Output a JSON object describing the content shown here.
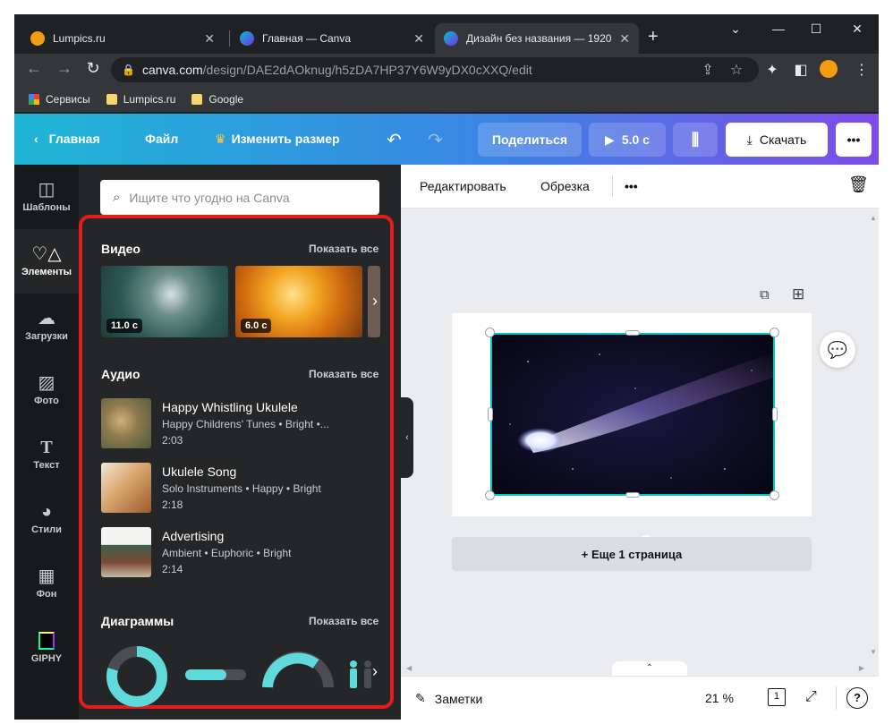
{
  "browser": {
    "tabs": [
      {
        "title": "Lumpics.ru",
        "close": "✕"
      },
      {
        "title": "Главная — Canva",
        "close": "✕"
      },
      {
        "title": "Дизайн без названия — 1920",
        "close": "✕"
      }
    ],
    "new_tab": "+",
    "window_controls": {
      "minimize": "—",
      "maximize": "☐",
      "close": "✕",
      "tabs_menu": "⌄"
    },
    "url_host": "canva.com",
    "url_path": "/design/DAE2dAOknug/h5zDA7HP37Y6W9yDX0cXXQ/edit",
    "bookmarks": [
      "Сервисы",
      "Lumpics.ru",
      "Google"
    ]
  },
  "header": {
    "home": "Главная",
    "file": "Файл",
    "resize": "Изменить размер",
    "share": "Поделиться",
    "play": "5.0 с",
    "download": "Скачать",
    "more": "•••"
  },
  "rail": [
    {
      "label": "Шаблоны",
      "icon": "templates-icon"
    },
    {
      "label": "Элементы",
      "icon": "elements-icon"
    },
    {
      "label": "Загрузки",
      "icon": "upload-icon"
    },
    {
      "label": "Фото",
      "icon": "photo-icon"
    },
    {
      "label": "Текст",
      "icon": "text-icon"
    },
    {
      "label": "Стили",
      "icon": "styles-icon"
    },
    {
      "label": "Фон",
      "icon": "background-icon"
    },
    {
      "label": "GIPHY",
      "icon": "giphy-icon"
    }
  ],
  "panel": {
    "search_placeholder": "Ищите что угодно на Canva",
    "show_all": "Показать все",
    "video": {
      "title": "Видео",
      "items": [
        {
          "duration": "11.0 с"
        },
        {
          "duration": "6.0 с"
        }
      ]
    },
    "audio": {
      "title": "Аудио",
      "tracks": [
        {
          "title": "Happy Whistling Ukulele",
          "tags": "Happy Childrens' Tunes • Bright •...",
          "duration": "2:03"
        },
        {
          "title": "Ukulele Song",
          "tags": "Solo Instruments • Happy • Bright",
          "duration": "2:18"
        },
        {
          "title": "Advertising",
          "tags": "Ambient • Euphoric • Bright",
          "duration": "2:14"
        }
      ]
    },
    "charts": {
      "title": "Диаграммы"
    }
  },
  "editor": {
    "edit": "Редактировать",
    "crop": "Обрезка",
    "more": "•••",
    "add_page": "+ Еще 1 страница",
    "notes": "Заметки",
    "zoom": "21 %",
    "page_count": "1",
    "help": "?"
  },
  "colors": {
    "accent": "#00c4cc",
    "highlight": "#e51c1c",
    "panel": "#252627"
  }
}
